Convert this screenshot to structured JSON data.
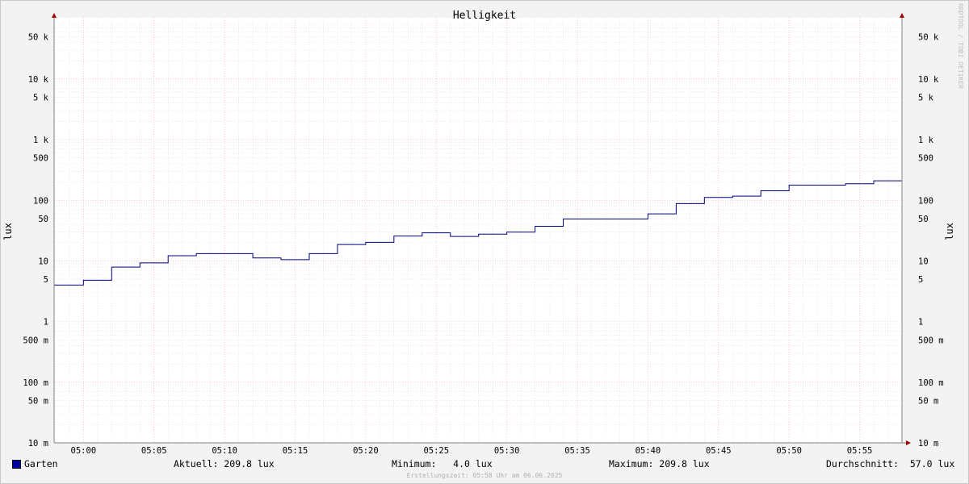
{
  "chart_data": {
    "type": "line",
    "title": "Helligkeit",
    "ylabel": "lux",
    "y_scale": "log",
    "ylim": [
      0.01,
      80000
    ],
    "x_ticks": [
      "05:00",
      "05:05",
      "05:10",
      "05:15",
      "05:20",
      "05:25",
      "05:30",
      "05:35",
      "05:40",
      "05:45",
      "05:50",
      "05:55"
    ],
    "y_ticks": [
      {
        "v": 50000,
        "label": "50 k"
      },
      {
        "v": 10000,
        "label": "10 k"
      },
      {
        "v": 5000,
        "label": "5 k"
      },
      {
        "v": 1000,
        "label": "1 k"
      },
      {
        "v": 500,
        "label": "500"
      },
      {
        "v": 100,
        "label": "100"
      },
      {
        "v": 50,
        "label": "50"
      },
      {
        "v": 10,
        "label": "10"
      },
      {
        "v": 5,
        "label": "5"
      },
      {
        "v": 1,
        "label": "1"
      },
      {
        "v": 0.5,
        "label": "500 m"
      },
      {
        "v": 0.1,
        "label": "100 m"
      },
      {
        "v": 0.05,
        "label": "50 m"
      },
      {
        "v": 0.01,
        "label": "10 m"
      }
    ],
    "series": [
      {
        "name": "Garten",
        "color": "#000080",
        "points": [
          [
            "04:58",
            4.0
          ],
          [
            "05:00",
            4.8
          ],
          [
            "05:02",
            7.9
          ],
          [
            "05:04",
            9.3
          ],
          [
            "05:06",
            12.2
          ],
          [
            "05:08",
            13.2
          ],
          [
            "05:12",
            11.2
          ],
          [
            "05:14",
            10.5
          ],
          [
            "05:16",
            13.2
          ],
          [
            "05:18",
            18.6
          ],
          [
            "05:20",
            20.3
          ],
          [
            "05:22",
            25.7
          ],
          [
            "05:24",
            29.1
          ],
          [
            "05:26",
            25.3
          ],
          [
            "05:28",
            27.6
          ],
          [
            "05:30",
            29.8
          ],
          [
            "05:32",
            37.2
          ],
          [
            "05:34",
            49.0
          ],
          [
            "05:40",
            59.7
          ],
          [
            "05:42",
            88.2
          ],
          [
            "05:44",
            111.5
          ],
          [
            "05:46",
            117.2
          ],
          [
            "05:48",
            143.3
          ],
          [
            "05:50",
            177.7
          ],
          [
            "05:54",
            187.8
          ],
          [
            "05:56",
            209.8
          ]
        ],
        "x_end": "05:58"
      }
    ],
    "grid": true,
    "legend": "bottom-left"
  },
  "legend": {
    "series_name": "Garten",
    "current": "Aktuell: 209.8 lux",
    "minimum": "Minimum:   4.0 lux",
    "maximum": "Maximum: 209.8 lux",
    "average": "Durchschnitt:  57.0 lux"
  },
  "footer": "Erstellungszeit: 05:58 Uhr am 06.06.2025",
  "watermark": "RRDTOOL / TOBI OETIKER"
}
